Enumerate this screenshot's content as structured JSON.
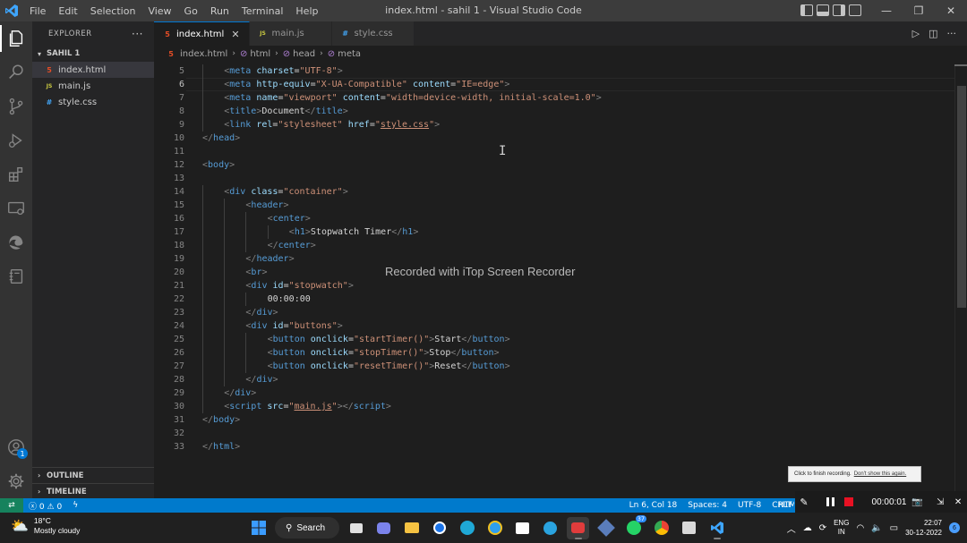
{
  "window": {
    "title": "index.html - sahil 1 - Visual Studio Code",
    "menu": [
      "File",
      "Edit",
      "Selection",
      "View",
      "Go",
      "Run",
      "Terminal",
      "Help"
    ]
  },
  "activity_bar": [
    "explorer-icon",
    "search-icon",
    "source-control-icon",
    "run-debug-icon",
    "extensions-icon",
    "remote-explorer-icon",
    "edge-devtools-icon",
    "notebook-icon"
  ],
  "accounts_badge": "1",
  "explorer": {
    "header": "EXPLORER",
    "more": "···",
    "folder": "SAHIL 1",
    "files": [
      {
        "name": "index.html",
        "type": "html",
        "icon": "5"
      },
      {
        "name": "main.js",
        "type": "js",
        "icon": "JS"
      },
      {
        "name": "style.css",
        "type": "css",
        "icon": "#"
      }
    ],
    "outline": "OUTLINE",
    "timeline": "TIMELINE"
  },
  "tabs": [
    {
      "label": "index.html",
      "active": true,
      "close": "✕"
    },
    {
      "label": "main.js",
      "active": false
    },
    {
      "label": "style.css",
      "active": false
    }
  ],
  "breadcrumb": [
    "index.html",
    "html",
    "head",
    "meta"
  ],
  "editor": {
    "current_line": 6,
    "lines": [
      {
        "n": 5,
        "indent": 2,
        "tokens": [
          [
            "b",
            "<"
          ],
          [
            "t",
            "meta"
          ],
          [
            "x",
            " "
          ],
          [
            "a",
            "charset"
          ],
          [
            "x",
            "="
          ],
          [
            "s",
            "\"UTF-8\""
          ],
          [
            "b",
            ">"
          ]
        ]
      },
      {
        "n": 6,
        "indent": 2,
        "tokens": [
          [
            "b",
            "<"
          ],
          [
            "t",
            "meta"
          ],
          [
            "x",
            " "
          ],
          [
            "a",
            "http-equiv"
          ],
          [
            "x",
            "="
          ],
          [
            "s",
            "\"X-UA-Compatible\""
          ],
          [
            "x",
            " "
          ],
          [
            "a",
            "content"
          ],
          [
            "x",
            "="
          ],
          [
            "s",
            "\"IE=edge\""
          ],
          [
            "b",
            ">"
          ]
        ]
      },
      {
        "n": 7,
        "indent": 2,
        "tokens": [
          [
            "b",
            "<"
          ],
          [
            "t",
            "meta"
          ],
          [
            "x",
            " "
          ],
          [
            "a",
            "name"
          ],
          [
            "x",
            "="
          ],
          [
            "s",
            "\"viewport\""
          ],
          [
            "x",
            " "
          ],
          [
            "a",
            "content"
          ],
          [
            "x",
            "="
          ],
          [
            "s",
            "\"width=device-width, initial-scale=1.0\""
          ],
          [
            "b",
            ">"
          ]
        ]
      },
      {
        "n": 8,
        "indent": 2,
        "tokens": [
          [
            "b",
            "<"
          ],
          [
            "t",
            "title"
          ],
          [
            "b",
            ">"
          ],
          [
            "x",
            "Document"
          ],
          [
            "b",
            "</"
          ],
          [
            "t",
            "title"
          ],
          [
            "b",
            ">"
          ]
        ]
      },
      {
        "n": 9,
        "indent": 2,
        "tokens": [
          [
            "b",
            "<"
          ],
          [
            "t",
            "link"
          ],
          [
            "x",
            " "
          ],
          [
            "a",
            "rel"
          ],
          [
            "x",
            "="
          ],
          [
            "s",
            "\"stylesheet\""
          ],
          [
            "x",
            " "
          ],
          [
            "a",
            "href"
          ],
          [
            "x",
            "="
          ],
          [
            "s",
            "\""
          ],
          [
            "u",
            "style.css"
          ],
          [
            "s",
            "\""
          ],
          [
            "b",
            ">"
          ]
        ]
      },
      {
        "n": 10,
        "indent": 0,
        "tokens": [
          [
            "b",
            "</"
          ],
          [
            "t",
            "head"
          ],
          [
            "b",
            ">"
          ]
        ]
      },
      {
        "n": 11,
        "indent": 0,
        "tokens": []
      },
      {
        "n": 12,
        "indent": 0,
        "tokens": [
          [
            "b",
            "<"
          ],
          [
            "t",
            "body"
          ],
          [
            "b",
            ">"
          ]
        ]
      },
      {
        "n": 13,
        "indent": 0,
        "tokens": []
      },
      {
        "n": 14,
        "indent": 2,
        "tokens": [
          [
            "b",
            "<"
          ],
          [
            "t",
            "div"
          ],
          [
            "x",
            " "
          ],
          [
            "a",
            "class"
          ],
          [
            "x",
            "="
          ],
          [
            "s",
            "\"container\""
          ],
          [
            "b",
            ">"
          ]
        ]
      },
      {
        "n": 15,
        "indent": 4,
        "tokens": [
          [
            "b",
            "<"
          ],
          [
            "t",
            "header"
          ],
          [
            "b",
            ">"
          ]
        ]
      },
      {
        "n": 16,
        "indent": 6,
        "tokens": [
          [
            "b",
            "<"
          ],
          [
            "t",
            "center"
          ],
          [
            "b",
            ">"
          ]
        ]
      },
      {
        "n": 17,
        "indent": 8,
        "tokens": [
          [
            "b",
            "<"
          ],
          [
            "t",
            "h1"
          ],
          [
            "b",
            ">"
          ],
          [
            "x",
            "Stopwatch Timer"
          ],
          [
            "b",
            "</"
          ],
          [
            "t",
            "h1"
          ],
          [
            "b",
            ">"
          ]
        ]
      },
      {
        "n": 18,
        "indent": 6,
        "tokens": [
          [
            "b",
            "</"
          ],
          [
            "t",
            "center"
          ],
          [
            "b",
            ">"
          ]
        ]
      },
      {
        "n": 19,
        "indent": 4,
        "tokens": [
          [
            "b",
            "</"
          ],
          [
            "t",
            "header"
          ],
          [
            "b",
            ">"
          ]
        ]
      },
      {
        "n": 20,
        "indent": 4,
        "tokens": [
          [
            "b",
            "<"
          ],
          [
            "t",
            "br"
          ],
          [
            "b",
            ">"
          ]
        ]
      },
      {
        "n": 21,
        "indent": 4,
        "tokens": [
          [
            "b",
            "<"
          ],
          [
            "t",
            "div"
          ],
          [
            "x",
            " "
          ],
          [
            "a",
            "id"
          ],
          [
            "x",
            "="
          ],
          [
            "s",
            "\"stopwatch\""
          ],
          [
            "b",
            ">"
          ]
        ]
      },
      {
        "n": 22,
        "indent": 6,
        "tokens": [
          [
            "x",
            "00:00:00"
          ]
        ]
      },
      {
        "n": 23,
        "indent": 4,
        "tokens": [
          [
            "b",
            "</"
          ],
          [
            "t",
            "div"
          ],
          [
            "b",
            ">"
          ]
        ]
      },
      {
        "n": 24,
        "indent": 4,
        "tokens": [
          [
            "b",
            "<"
          ],
          [
            "t",
            "div"
          ],
          [
            "x",
            " "
          ],
          [
            "a",
            "id"
          ],
          [
            "x",
            "="
          ],
          [
            "s",
            "\"buttons\""
          ],
          [
            "b",
            ">"
          ]
        ]
      },
      {
        "n": 25,
        "indent": 6,
        "tokens": [
          [
            "b",
            "<"
          ],
          [
            "t",
            "button"
          ],
          [
            "x",
            " "
          ],
          [
            "a",
            "onclick"
          ],
          [
            "x",
            "="
          ],
          [
            "s",
            "\"startTimer()\""
          ],
          [
            "b",
            ">"
          ],
          [
            "x",
            "Start"
          ],
          [
            "b",
            "</"
          ],
          [
            "t",
            "button"
          ],
          [
            "b",
            ">"
          ]
        ]
      },
      {
        "n": 26,
        "indent": 6,
        "tokens": [
          [
            "b",
            "<"
          ],
          [
            "t",
            "button"
          ],
          [
            "x",
            " "
          ],
          [
            "a",
            "onclick"
          ],
          [
            "x",
            "="
          ],
          [
            "s",
            "\"stopTimer()\""
          ],
          [
            "b",
            ">"
          ],
          [
            "x",
            "Stop"
          ],
          [
            "b",
            "</"
          ],
          [
            "t",
            "button"
          ],
          [
            "b",
            ">"
          ]
        ]
      },
      {
        "n": 27,
        "indent": 6,
        "tokens": [
          [
            "b",
            "<"
          ],
          [
            "t",
            "button"
          ],
          [
            "x",
            " "
          ],
          [
            "a",
            "onclick"
          ],
          [
            "x",
            "="
          ],
          [
            "s",
            "\"resetTimer()\""
          ],
          [
            "b",
            ">"
          ],
          [
            "x",
            "Reset"
          ],
          [
            "b",
            "</"
          ],
          [
            "t",
            "button"
          ],
          [
            "b",
            ">"
          ]
        ]
      },
      {
        "n": 28,
        "indent": 4,
        "tokens": [
          [
            "b",
            "</"
          ],
          [
            "t",
            "div"
          ],
          [
            "b",
            ">"
          ]
        ]
      },
      {
        "n": 29,
        "indent": 2,
        "tokens": [
          [
            "b",
            "</"
          ],
          [
            "t",
            "div"
          ],
          [
            "b",
            ">"
          ]
        ]
      },
      {
        "n": 30,
        "indent": 2,
        "tokens": [
          [
            "b",
            "<"
          ],
          [
            "t",
            "script"
          ],
          [
            "x",
            " "
          ],
          [
            "a",
            "src"
          ],
          [
            "x",
            "="
          ],
          [
            "s",
            "\""
          ],
          [
            "u",
            "main.js"
          ],
          [
            "s",
            "\""
          ],
          [
            "b",
            "></"
          ],
          [
            "t",
            "script"
          ],
          [
            "b",
            ">"
          ]
        ]
      },
      {
        "n": 31,
        "indent": 0,
        "tokens": [
          [
            "b",
            "</"
          ],
          [
            "t",
            "body"
          ],
          [
            "b",
            ">"
          ]
        ]
      },
      {
        "n": 32,
        "indent": 0,
        "tokens": []
      },
      {
        "n": 33,
        "indent": 0,
        "tokens": [
          [
            "b",
            "</"
          ],
          [
            "t",
            "html"
          ],
          [
            "b",
            ">"
          ]
        ]
      }
    ]
  },
  "watermark": "Recorded with iTop Screen Recorder",
  "recording_hint": {
    "text": "Click to finish recording.",
    "link": "Don't show this again."
  },
  "recorder": {
    "time": "00:00:01"
  },
  "statusbar": {
    "remote": "⇄",
    "errors": "0",
    "warnings": "0",
    "position": "Ln 6, Col 18",
    "spaces": "Spaces: 4",
    "encoding": "UTF-8",
    "eol": "CRLF",
    "language": "HTML"
  },
  "taskbar": {
    "weather_temp": "18°C",
    "weather_cond": "Mostly cloudy",
    "search": "Search",
    "whatsapp_badge": "37",
    "lang_top": "ENG",
    "lang_bottom": "IN",
    "time": "22:07",
    "date": "30-12-2022",
    "notifications": "6"
  },
  "colors": {
    "accent": "#007acc",
    "tag": "#569cd6",
    "attr": "#9cdcfe",
    "string": "#ce9178",
    "text": "#d4d4d4"
  }
}
